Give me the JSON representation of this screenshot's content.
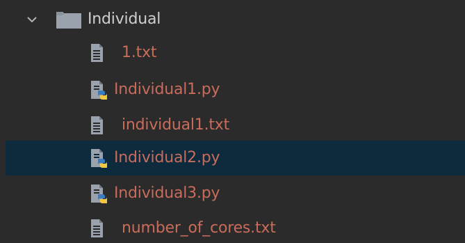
{
  "project_tree": {
    "folder": {
      "label": "Individual",
      "expanded": true,
      "icon": "folder-icon",
      "color": "#cfcfcf"
    },
    "files": [
      {
        "label": "1.txt",
        "icon": "text-file-icon",
        "selected": false
      },
      {
        "label": "Individual1.py",
        "icon": "python-file-icon",
        "selected": false
      },
      {
        "label": "individual1.txt",
        "icon": "text-file-icon",
        "selected": false
      },
      {
        "label": "Individual2.py",
        "icon": "python-file-icon",
        "selected": true
      },
      {
        "label": "Individual3.py",
        "icon": "python-file-icon",
        "selected": false
      },
      {
        "label": "number_of_cores.txt",
        "icon": "text-file-icon",
        "selected": false
      }
    ],
    "colors": {
      "background": "#2b2b2b",
      "selection": "#0e2a3d",
      "file_label": "#c96c5b",
      "folder_label": "#cfcfcf"
    }
  }
}
